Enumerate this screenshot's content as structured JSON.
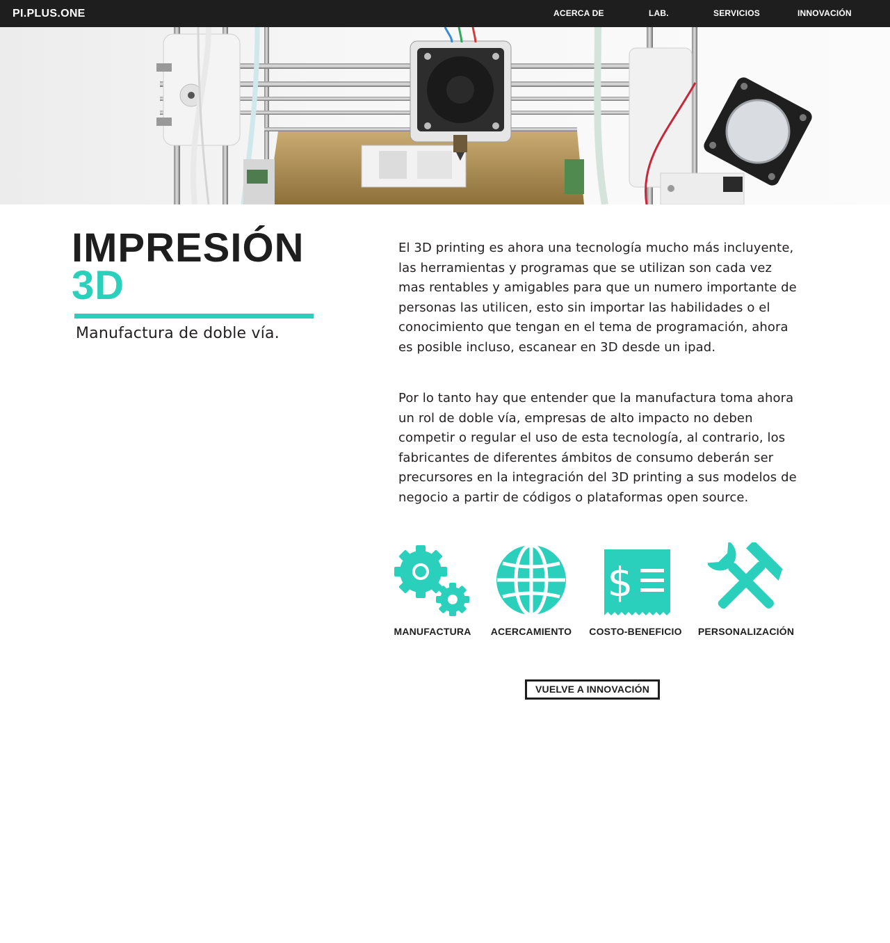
{
  "nav": {
    "brand": "PI.PLUS.ONE",
    "links": [
      "ACERCA DE",
      "LAB.",
      "SERVICIOS",
      "INNOVACIÓN"
    ]
  },
  "hero": {
    "image": "3D printer close-up"
  },
  "heading": {
    "line1": "IMPRESIÓN",
    "line2": "3D"
  },
  "subtitle": "Manufactura de doble vía.",
  "paragraphs": [
    "El 3D printing es ahora una tecnología mucho más incluyente, las herramientas y programas que se utilizan son cada vez mas rentables y amigables para que un numero importante de personas las utilicen, esto sin importar las habilidades o el conocimiento que tengan en el tema de programación, ahora es posible incluso, escanear en 3D desde un ipad.",
    "Por lo tanto hay que entender que la manufactura toma ahora un rol de doble vía, empresas de alto impacto no deben competir o regular el uso de esta tecnología, al contrario, los fabricantes de diferentes ámbitos de consumo deberán ser precursores en la integración del 3D printing a sus modelos de negocio a partir de códigos o plataformas open source."
  ],
  "features": [
    {
      "label": "MANUFACTURA",
      "icon": "gears-icon"
    },
    {
      "label": "ACERCAMIENTO",
      "icon": "globe-icon"
    },
    {
      "label": "COSTO-BENEFICIO",
      "icon": "receipt-icon"
    },
    {
      "label": "PERSONALIZACIÓN",
      "icon": "tools-icon"
    }
  ],
  "back_button": "VUELVE A INNOVACIÓN",
  "colors": {
    "accent": "#2bd0bc",
    "nav_bg": "#1e1e1e",
    "text": "#231f20"
  }
}
